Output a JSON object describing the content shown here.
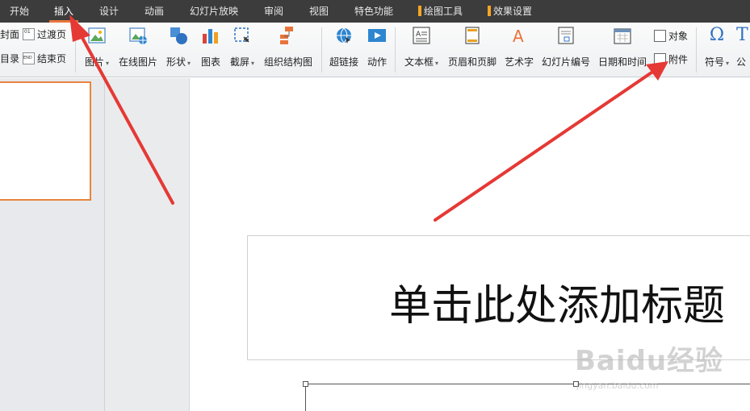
{
  "menu": {
    "items": [
      "开始",
      "插入",
      "设计",
      "动画",
      "幻灯片放映",
      "审阅",
      "视图",
      "特色功能"
    ],
    "tool_tabs": [
      "绘图工具",
      "效果设置"
    ],
    "active": "插入"
  },
  "ribbon": {
    "cover": "封面",
    "toc": "目录",
    "transition_page": "过渡页",
    "end_page": "结束页",
    "picture": "图片",
    "online_picture": "在线图片",
    "shape": "形状",
    "chart": "图表",
    "screenshot": "截屏",
    "org_chart": "组织结构图",
    "hyperlink": "超链接",
    "action": "动作",
    "textbox": "文本框",
    "header_footer": "页眉和页脚",
    "wordart": "艺术字",
    "slide_number": "幻灯片编号",
    "datetime": "日期和时间",
    "object": "对象",
    "attachment": "附件",
    "symbol": "符号",
    "formula": "公"
  },
  "slide": {
    "title_placeholder": "单击此处添加标题"
  },
  "watermark": {
    "main": "Baidu经验",
    "sub": "jingyan.baidu.com"
  },
  "colors": {
    "menubar_bg": "#3c3c3c",
    "active_underline": "#e8743b",
    "arrow": "#e53935",
    "thumb_border": "#e8843e"
  }
}
